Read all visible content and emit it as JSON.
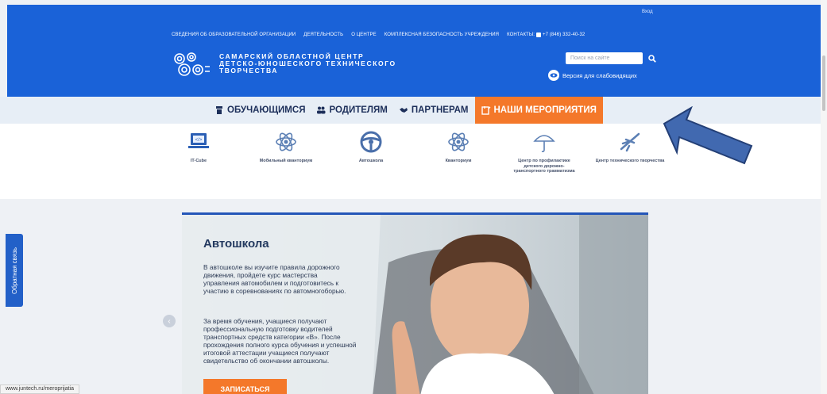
{
  "header": {
    "login": "Вход",
    "nav": [
      "СВЕДЕНИЯ ОБ ОБРАЗОВАТЕЛЬНОЙ ОРГАНИЗАЦИИ",
      "ДЕЯТЕЛЬНОСТЬ",
      "О ЦЕНТРЕ",
      "КОМПЛЕКСНАЯ БЕЗОПАСНОСТЬ УЧРЕЖДЕНИЯ"
    ],
    "contacts_label": "КОНТАКТЫ:",
    "phone": "+7 (846) 332-40-32",
    "logo_lines": [
      "САМАРСКИЙ ОБЛАСТНОЙ ЦЕНТР",
      "ДЕТСКО-ЮНОШЕСКОГО ТЕХНИЧЕСКОГО",
      "ТВОРЧЕСТВА"
    ],
    "search_placeholder": "Поиск на сайте",
    "low_vision": "Версия для слабовидящих"
  },
  "categories": [
    {
      "label": "ОБУЧАЮЩИМСЯ",
      "icon": "graduation-icon"
    },
    {
      "label": "РОДИТЕЛЯМ",
      "icon": "people-icon"
    },
    {
      "label": "ПАРТНЕРАМ",
      "icon": "handshake-icon"
    },
    {
      "label": "НАШИ МЕРОПРИЯТИЯ",
      "icon": "events-icon",
      "active": true
    }
  ],
  "directions": [
    {
      "label": "IT-Cube",
      "icon": "laptop-code-icon"
    },
    {
      "label": "Мобильный кванториум",
      "icon": "atom-icon"
    },
    {
      "label": "Автошкола",
      "icon": "steering-wheel-icon"
    },
    {
      "label": "Кванториум",
      "icon": "atom-icon"
    },
    {
      "label": "Центр по профилактике детского дорожно-транспортного травматизма",
      "icon": "umbrella-icon"
    },
    {
      "label": "Центр технического творчества",
      "icon": "plane-icon"
    }
  ],
  "feedback": "Обратная связь",
  "slide": {
    "title": "Автошкола",
    "description": "В автошколе вы изучите правила дорожного движения, пройдете курс мастерства управления автомобилем и подготовитесь к участию в соревнованиях по автомногоборью.",
    "more": "За время обучения, учащиеся получают профессиональную подготовку водителей транспортных средств категории «В». После прохождения полного курса обучения и успешной итоговой аттестации учащиеся получают свидетельство об окончании автошколы.",
    "button": "ЗАПИСАТЬСЯ"
  },
  "status_url": "www.juntech.ru/meroprijatia",
  "colors": {
    "brand_blue": "#1a62d8",
    "accent_orange": "#f4782a",
    "arrow_blue": "#3f6ab0"
  }
}
